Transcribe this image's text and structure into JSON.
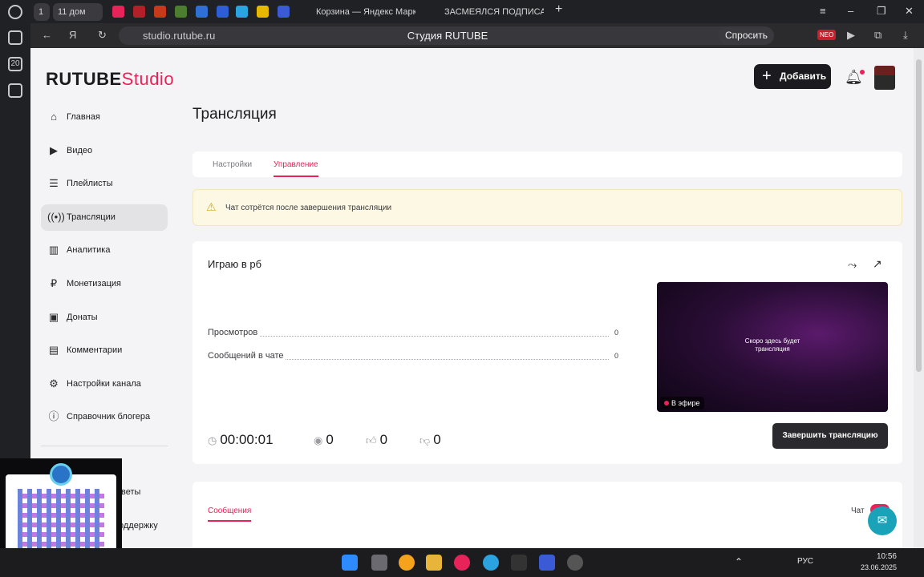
{
  "browser": {
    "tabs": [
      {
        "label": "1"
      },
      {
        "label": "11 дом"
      },
      {
        "label": "Корзина — Яндекс Марке"
      },
      {
        "label": "ЗАСМЕЯЛСЯ ПОДПИСАЛ"
      }
    ],
    "url": "studio.rutube.ru",
    "page_title": "Студия RUTUBE",
    "ask_label": "Спросить",
    "ext_badge": "NEO"
  },
  "os_sidebar": [
    "20"
  ],
  "header": {
    "logo_main": "RUTUBE",
    "logo_studio": "Studio",
    "add_label": "Добавить"
  },
  "sidebar": {
    "items": [
      {
        "label": "Главная",
        "icon": "home-icon"
      },
      {
        "label": "Видео",
        "icon": "video-icon"
      },
      {
        "label": "Плейлисты",
        "icon": "playlist-icon"
      },
      {
        "label": "Трансляции",
        "icon": "broadcast-icon",
        "active": true
      },
      {
        "label": "Аналитика",
        "icon": "analytics-icon"
      },
      {
        "label": "Монетизация",
        "icon": "ruble-icon"
      },
      {
        "label": "Донаты",
        "icon": "wallet-icon"
      },
      {
        "label": "Комментарии",
        "icon": "comment-icon"
      },
      {
        "label": "Настройки канала",
        "icon": "gear-icon"
      },
      {
        "label": "Справочник блогера",
        "icon": "info-icon"
      }
    ],
    "lower": [
      "веты",
      "оддержку"
    ]
  },
  "main": {
    "title": "Трансляция",
    "tabs": [
      "Настройки",
      "Управление"
    ],
    "active_tab": "Управление",
    "warning": "Чат сотрётся после завершения трансляции",
    "stream": {
      "name": "Играю в рб",
      "stats": [
        {
          "label": "Просмотров",
          "value": "0"
        },
        {
          "label": "Сообщений в чате",
          "value": "0"
        }
      ],
      "preview_text": "Скоро здесь будет трансляция",
      "live_label": "В эфире",
      "duration": "00:00:01",
      "viewers": "0",
      "likes": "0",
      "dislikes": "0",
      "end_label": "Завершить трансляцию"
    },
    "messages": {
      "tab_label": "Сообщения",
      "chat_label": "Чат"
    }
  },
  "taskbar": {
    "lang": "РУС",
    "time": "10:56",
    "date": "23.06.2025"
  },
  "colors": {
    "accent": "#e8235a",
    "warning_bg": "#fdf8e3",
    "dark_button": "#1b1b1f"
  }
}
